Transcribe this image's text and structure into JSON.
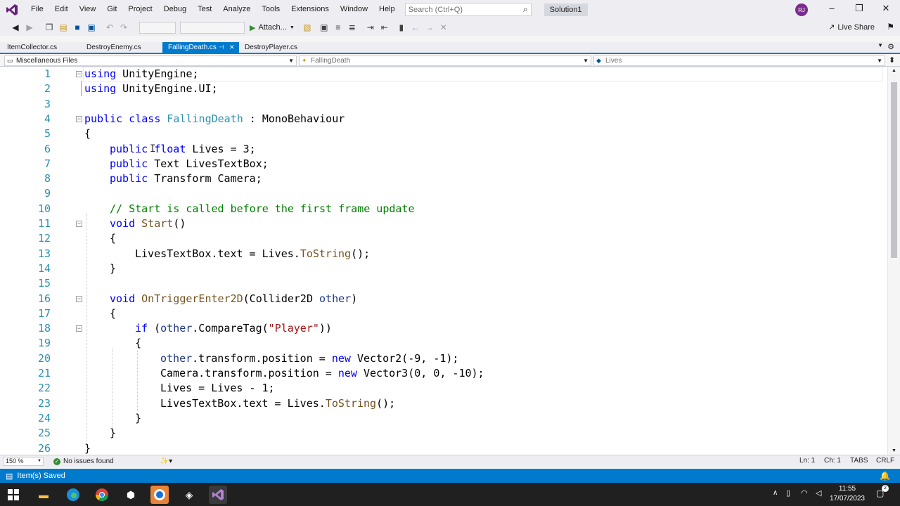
{
  "menu": [
    "File",
    "Edit",
    "View",
    "Git",
    "Project",
    "Debug",
    "Test",
    "Analyze",
    "Tools",
    "Extensions",
    "Window",
    "Help"
  ],
  "search": {
    "placeholder": "Search (Ctrl+Q)"
  },
  "solution_name": "Solution1",
  "user_initials": "RJ",
  "toolbar": {
    "attach_label": "Attach...",
    "live_share_label": "Live Share"
  },
  "tabs": [
    {
      "label": "ItemCollector.cs",
      "active": false
    },
    {
      "label": "DestroyEnemy.cs",
      "active": false
    },
    {
      "label": "FallingDeath.cs",
      "active": true
    },
    {
      "label": "DestroyPlayer.cs",
      "active": false
    }
  ],
  "navbar": {
    "project": "Miscellaneous Files",
    "type": "FallingDeath",
    "member": "Lives"
  },
  "code_lines": [
    "1",
    "2",
    "3",
    "4",
    "5",
    "6",
    "7",
    "8",
    "9",
    "10",
    "11",
    "12",
    "13",
    "14",
    "15",
    "16",
    "17",
    "18",
    "19",
    "20",
    "21",
    "22",
    "23",
    "24",
    "25",
    "26"
  ],
  "code": {
    "l1": [
      "using",
      " UnityEngine;"
    ],
    "l2": [
      "using",
      " UnityEngine.UI;"
    ],
    "l4": [
      "public",
      " ",
      "class",
      " ",
      "FallingDeath",
      " : MonoBehaviour"
    ],
    "l5": "{",
    "l6": [
      "public",
      " ",
      "float",
      " Lives = 3;"
    ],
    "l7": [
      "public",
      " Text LivesTextBox;"
    ],
    "l8": [
      "public",
      " Transform Camera;"
    ],
    "l10": "// Start is called before the first frame update",
    "l11": [
      "void",
      " ",
      "Start",
      "()"
    ],
    "l12": "{",
    "l13": [
      "LivesTextBox.text = Lives.",
      "ToString",
      "();"
    ],
    "l14": "}",
    "l16": [
      "void",
      " ",
      "OnTriggerEnter2D",
      "(Collider2D ",
      "other",
      ")"
    ],
    "l17": "{",
    "l18": [
      "if",
      " (",
      "other",
      ".CompareTag(",
      "\"Player\"",
      "))"
    ],
    "l19": "{",
    "l20": [
      "other",
      ".transform.position = ",
      "new",
      " Vector2(-9, -1);"
    ],
    "l21": [
      "Camera.transform.position = ",
      "new",
      " Vector3(0, 0, -10);"
    ],
    "l22": "Lives = Lives - 1;",
    "l23": [
      "LivesTextBox.text = Lives.",
      "ToString",
      "();"
    ],
    "l24": "}",
    "l25": "}",
    "l26": "}"
  },
  "bottombar": {
    "zoom": "150 %",
    "issues": "No issues found",
    "ln": "Ln: 1",
    "ch": "Ch: 1",
    "tabs": "TABS",
    "eol": "CRLF"
  },
  "status": {
    "message": "Item(s) Saved"
  },
  "taskbar": {
    "time": "11:55",
    "date": "17/07/2023",
    "notifications": "2"
  },
  "colors": {
    "accent": "#007acc",
    "keyword": "#0000ff",
    "type": "#2b91af",
    "comment": "#008000",
    "string": "#a31515"
  }
}
